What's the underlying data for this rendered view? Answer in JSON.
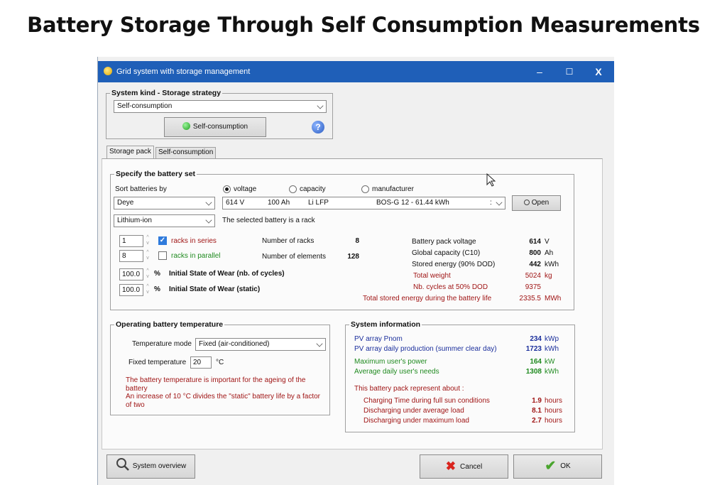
{
  "page_title": "Battery Storage Through Self Consumption Measurements",
  "window": {
    "title": "Grid system with storage management",
    "minimize": "–",
    "maximize": "☐",
    "close": "X"
  },
  "system_kind": {
    "group_label": "System kind - Storage strategy",
    "selected": "Self-consumption",
    "button_label": "Self-consumption",
    "help": "?"
  },
  "tabs": [
    {
      "label": "Storage pack",
      "active": true
    },
    {
      "label": "Self-consumption",
      "active": false
    }
  ],
  "battery_set": {
    "group_label": "Specify the battery set",
    "sort_label": "Sort batteries by",
    "sort_options": [
      "voltage",
      "capacity",
      "manufacturer"
    ],
    "sort_selected": "voltage",
    "manufacturer": "Deye",
    "model": {
      "voltage": "614 V",
      "capacity": "100 Ah",
      "tech": "Li LFP",
      "name": "BOS-G 12 - 61.44 kWh",
      "marker": ":"
    },
    "open_button": "Open",
    "technology": "Lithium-ion",
    "note": "The selected battery is a rack",
    "racks_series_value": "1",
    "racks_series_label": "racks in series",
    "racks_series_checked": true,
    "racks_parallel_value": "8",
    "racks_parallel_label": "racks in parallel",
    "racks_parallel_checked": false,
    "wear_cycles_value": "100.0",
    "wear_static_value": "100.0",
    "percent": "%",
    "wear_cycles_label": "Initial State of Wear (nb. of cycles)",
    "wear_static_label": "Initial State of Wear (static)",
    "num_racks_label": "Number of racks",
    "num_racks_value": "8",
    "num_elements_label": "Number of elements",
    "num_elements_value": "128",
    "stats": [
      {
        "label": "Battery pack voltage",
        "value": "614",
        "unit": "V",
        "color": "black"
      },
      {
        "label": "Global capacity (C10)",
        "value": "800",
        "unit": "Ah",
        "color": "black"
      },
      {
        "label": "Stored energy (90% DOD)",
        "value": "442",
        "unit": "kWh",
        "color": "black"
      },
      {
        "label": "Total weight",
        "value": "5024",
        "unit": "kg",
        "color": "red"
      },
      {
        "label": "Nb. cycles at 50% DOD",
        "value": "9375",
        "unit": "",
        "color": "red"
      },
      {
        "label": "Total stored energy during the battery life",
        "value": "2335.5",
        "unit": "MWh",
        "color": "red"
      }
    ]
  },
  "temperature": {
    "group_label": "Operating battery temperature",
    "mode_label": "Temperature mode",
    "mode_value": "Fixed (air-conditioned)",
    "fixed_label": "Fixed temperature",
    "fixed_value": "20",
    "fixed_unit": "°C",
    "note1": "The battery temperature is important for the ageing of the battery",
    "note2": "An increase of 10 °C divides the \"static\" battery life by a factor of two"
  },
  "system_info": {
    "group_label": "System information",
    "rows": [
      {
        "label": "PV array Pnom",
        "value": "234",
        "unit": "kWp",
        "color": "blue"
      },
      {
        "label": "PV array daily production (summer clear day)",
        "value": "1723",
        "unit": "kWh",
        "color": "blue"
      },
      {
        "label": "Maximum user's power",
        "value": "164",
        "unit": "kW",
        "color": "green"
      },
      {
        "label": "Average daily user's needs",
        "value": "1308",
        "unit": "kWh",
        "color": "green"
      }
    ],
    "represent_label": "This battery pack represent about :",
    "represent_rows": [
      {
        "label": "Charging Time during full sun conditions",
        "value": "1.9",
        "unit": "hours"
      },
      {
        "label": "Discharging under average load",
        "value": "8.1",
        "unit": "hours"
      },
      {
        "label": "Discharging under maximum load",
        "value": "2.7",
        "unit": "hours"
      }
    ]
  },
  "footer": {
    "overview": "System overview",
    "cancel": "Cancel",
    "ok": "OK"
  },
  "colors": {
    "titlebar": "#1f5fb8",
    "red_text": "#a01616",
    "blue_text": "#1b2f9c",
    "green_text": "#1f8a1f"
  }
}
